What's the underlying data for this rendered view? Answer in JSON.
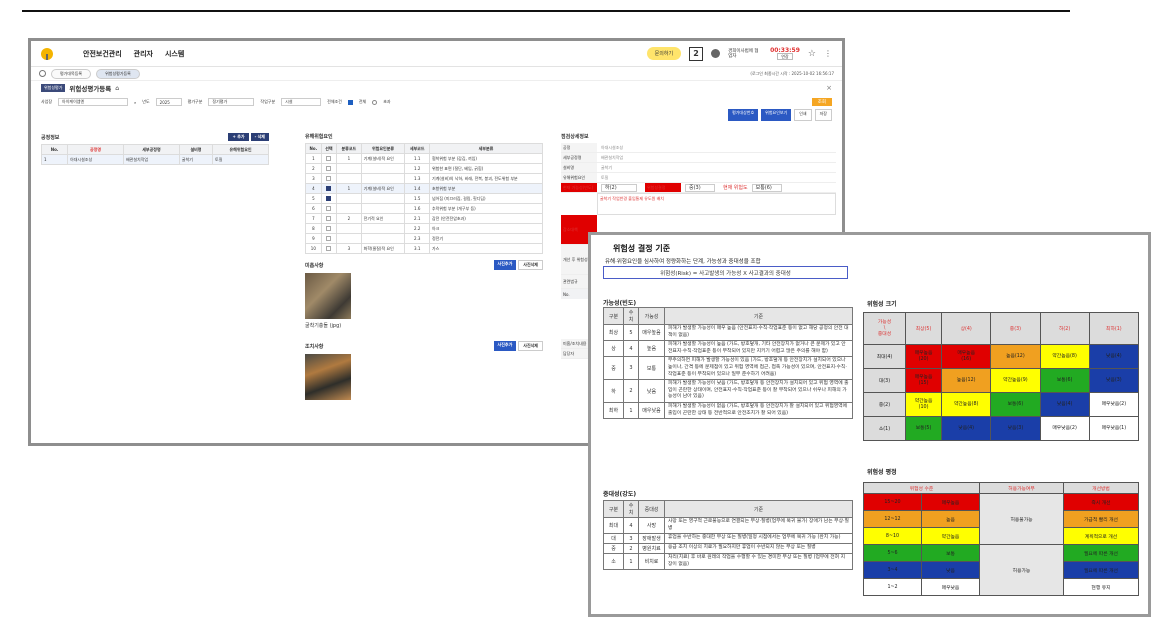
{
  "app": {
    "nav": [
      "안전보건관리",
      "관리자",
      "시스템"
    ],
    "pill_label": "문의하기",
    "notification_count": "2",
    "user_name": "경희이사범에 협업자",
    "timer": "00:33:59",
    "extend_label": "연장",
    "tabs": [
      "평가대목등록",
      "위험성평가등록"
    ],
    "login_time": "(로그인 최종시간 시작 : 2025-10-02 16:56:17",
    "page_tag": "위험성평가",
    "page_title": "위험성평가등록",
    "filters": {
      "site_label": "사업장",
      "site_value": "아이케이엠엔",
      "year_label": "년도",
      "year_value": "2025",
      "type_label": "평가구분",
      "type_value": "정기평가",
      "dept_label": "작업구분",
      "dept_value": "시설",
      "scope_label": "전체조건",
      "scope_all": "전체",
      "scope_part": "초과"
    },
    "search_label": "조회",
    "top_buttons": [
      "평가대상번호",
      "위험요인보기",
      "인쇄",
      "저장"
    ],
    "process": {
      "title": "공정정보",
      "add": "+ 추가",
      "del": "- 삭제",
      "headers": [
        "No.",
        "공정명",
        "세부공정명",
        "설비명",
        "유해위험요인"
      ],
      "rows": [
        [
          "1",
          "아대시설조성",
          "배관설치작업",
          "굴착기",
          "토질"
        ]
      ]
    },
    "hazards": {
      "title": "유해위험요인",
      "headers": [
        "No.",
        "선택",
        "분류코드",
        "위험요인분류",
        "세부코드",
        "세부분류"
      ],
      "rows": [
        [
          "1",
          "",
          "1",
          "기계(설비)적 요인",
          "1.1",
          "협착위험 부분 (감김, 끼임)"
        ],
        [
          "2",
          "",
          "",
          "",
          "1.2",
          "위험한 표면 (절단, 베임, 긁힘)"
        ],
        [
          "3",
          "",
          "",
          "",
          "1.3",
          "기계(설비)의 낙하, 비래, 전복, 붕괴, 전도위험 부분"
        ],
        [
          "4",
          "on",
          "1",
          "기계(설비)적 요인",
          "1.4",
          "초항위험 부분"
        ],
        [
          "5",
          "on",
          "",
          "",
          "1.5",
          "넘어짐 (미끄러짐, 걸림, 헛디딤)"
        ],
        [
          "6",
          "",
          "",
          "",
          "1.6",
          "추락위험 부분 (개구부 등)"
        ],
        [
          "7",
          "",
          "2",
          "전기적 요인",
          "2.1",
          "감전 (안전전압초과)"
        ],
        [
          "8",
          "",
          "",
          "",
          "2.2",
          "아크"
        ],
        [
          "9",
          "",
          "",
          "",
          "2.3",
          "정전기"
        ],
        [
          "10",
          "",
          "3",
          "화학(물질)적 요인",
          "3.1",
          "가스"
        ]
      ]
    },
    "photos": {
      "improve_title": "미흡사항",
      "upload": "사진추가",
      "delete": "사진삭제",
      "improve_caption": "굴착기충돌 (jpg)",
      "measure_title": "조치사항"
    },
    "detail": {
      "title": "점검상세정보",
      "labels": [
        "공정",
        "세부공정명",
        "설비명",
        "유해위험요인",
        "현재 가능성(빈도)",
        "위험성결정",
        "감소대책",
        "개선 후 위험성",
        "관련법규"
      ],
      "values": [
        "아대시설조성",
        "배관설치작업",
        "굴착기",
        "토질",
        "하(2)",
        "중(3)",
        "",
        "",
        ""
      ],
      "grade_label": "현재 위험도",
      "grade_value": "보통(6)",
      "note": "굴착기 작업반경 출입통제 유도원 배치",
      "law_no": "No.",
      "extra_labels": [
        "미흡/조치내용",
        "담당자"
      ]
    }
  },
  "doc": {
    "title": "위험성 결정 기준",
    "subtitle": "유해·위험요인을 심사하여 정량화하는 단계, 가능성과 중대성을 조합",
    "formula": "위험성(Risk) = 사고발생의 가능성 X 사고결과의 중대성",
    "freq": {
      "heading": "가능성(빈도)",
      "headers": [
        "구분",
        "수치",
        "가능성",
        "기준"
      ],
      "rows": [
        [
          "최상",
          "5",
          "매우높음",
          "피해가 발생할 가능성이 매우 높음 (안전표지·수칙·작업표준 등이 없고 해당 공정의 안전 대책이 없음)"
        ],
        [
          "상",
          "4",
          "높음",
          "피해가 발생할 가능성이 높음 (가드, 방호덮개, 기타 안전장치가 없거나 큰 문제가 있고 안전표지·수칙·작업표준 등이 부착되어 있지만 지키기 어렵고 많은 주의를 해야 함)"
        ],
        [
          "중",
          "3",
          "보통",
          "부주의하면 피해가 발생할 가능성이 있음 (가드, 방호덮개 등 안전장치가 설치되어 있으나 높이나, 간격 등에 문제점이 있고 위험 영역에 접근, 접촉 가능성이 있으며, 안전표지·수칙·작업표준 등이 부착되어 있으나 일부 준수하기 어려움)"
        ],
        [
          "하",
          "2",
          "낮음",
          "피해가 발생할 가능성이 낮음 (가드, 방호덮개 등 안전장치가 설치되어 있고 위험 영역에 출입이 곤란한 상태이며, 안전표지·수칙·작업표준 등이 잘 부착되어 있으나 쉬우나 피해의 가능성이 남아 있음)"
        ],
        [
          "최하",
          "1",
          "매우낮음",
          "피해가 발생할 가능성이 없음 (가드, 방호덮개 등 안전장치가 잘 설치되어 있고 위험영역에 출입이 곤란한 상태 등 전반적으로 안전조치가 잘 되어 있음)"
        ]
      ]
    },
    "sev": {
      "heading": "중대성(강도)",
      "headers": [
        "구분",
        "수치",
        "중대성",
        "기준"
      ],
      "rows": [
        [
          "최대",
          "4",
          "사망",
          "사망 또는 영구적 근로불능으로 연결되는 부상·질병(업무에 복귀 불가) 장애가 남는 부상·질병"
        ],
        [
          "대",
          "3",
          "장애발생",
          "휴업을 수반하는 중대한 부상 또는 질병(일정 시점에서는 업무에 복귀 가능 (완치 가능)"
        ],
        [
          "중",
          "2",
          "병원치료",
          "응급 조치 이상의 치료가 필요하지만 휴업이 수반되지 않는 부상 또는 질병"
        ],
        [
          "소",
          "1",
          "비치료",
          "처리(치료) 후 바로 원래의 작업을 수행할 수 있는 경미한 부상 또는 질병 (업무에 전혀 지장이 없음)"
        ]
      ]
    },
    "matrix": {
      "heading": "위험성 크기",
      "corner_top": "가능성",
      "corner_mid": "\\",
      "corner_bottom": "중대성",
      "cols": [
        "최상(5)",
        "상(4)",
        "중(3)",
        "하(2)",
        "최하(1)"
      ],
      "rows": [
        {
          "label": "최대(4)",
          "cells": [
            "매우높음\n(20)",
            "매우높음\n(16)",
            "높음(12)",
            "약간높음(8)",
            "낮음(4)"
          ],
          "colors": [
            "red",
            "red",
            "orange",
            "yellow",
            "blue"
          ]
        },
        {
          "label": "대(3)",
          "cells": [
            "매우높음\n(15)",
            "높음(12)",
            "약간높음(9)",
            "보통(6)",
            "낮음(3)"
          ],
          "colors": [
            "red",
            "orange",
            "yellow",
            "green",
            "blue"
          ]
        },
        {
          "label": "중(2)",
          "cells": [
            "약간높음\n(10)",
            "약간높음(8)",
            "보통(6)",
            "낮음(4)",
            "매우낮음(2)"
          ],
          "colors": [
            "yellow",
            "yellow",
            "green",
            "blue",
            "white"
          ]
        },
        {
          "label": "소(1)",
          "cells": [
            "보통(5)",
            "낮음(4)",
            "낮음(3)",
            "매우낮음(2)",
            "매우낮음(1)"
          ],
          "colors": [
            "green",
            "blue",
            "blue",
            "white",
            "white"
          ]
        }
      ]
    },
    "evaluation": {
      "heading": "위험성 평정",
      "headers": [
        "위험성 수준",
        "허용가능여부",
        "개선방법"
      ],
      "rows": [
        {
          "range": "15~20",
          "level": "매우높음",
          "method": "즉시 개선",
          "color": "red"
        },
        {
          "range": "12~12",
          "level": "높음",
          "method": "가급적 빨리 개선",
          "color": "orange"
        },
        {
          "range": "8~10",
          "level": "약간높음",
          "method": "계획적으로 개선",
          "color": "yellow"
        },
        {
          "range": "5~6",
          "level": "보통",
          "method": "필요에 따른 개선",
          "color": "green"
        },
        {
          "range": "3~4",
          "level": "낮음",
          "method": "필요에 따른 개선",
          "color": "blue"
        },
        {
          "range": "1~2",
          "level": "매우낮음",
          "method": "현행 유지",
          "color": "white"
        }
      ],
      "not_allowed": "허용불가능",
      "allowed": "허용가능"
    }
  }
}
